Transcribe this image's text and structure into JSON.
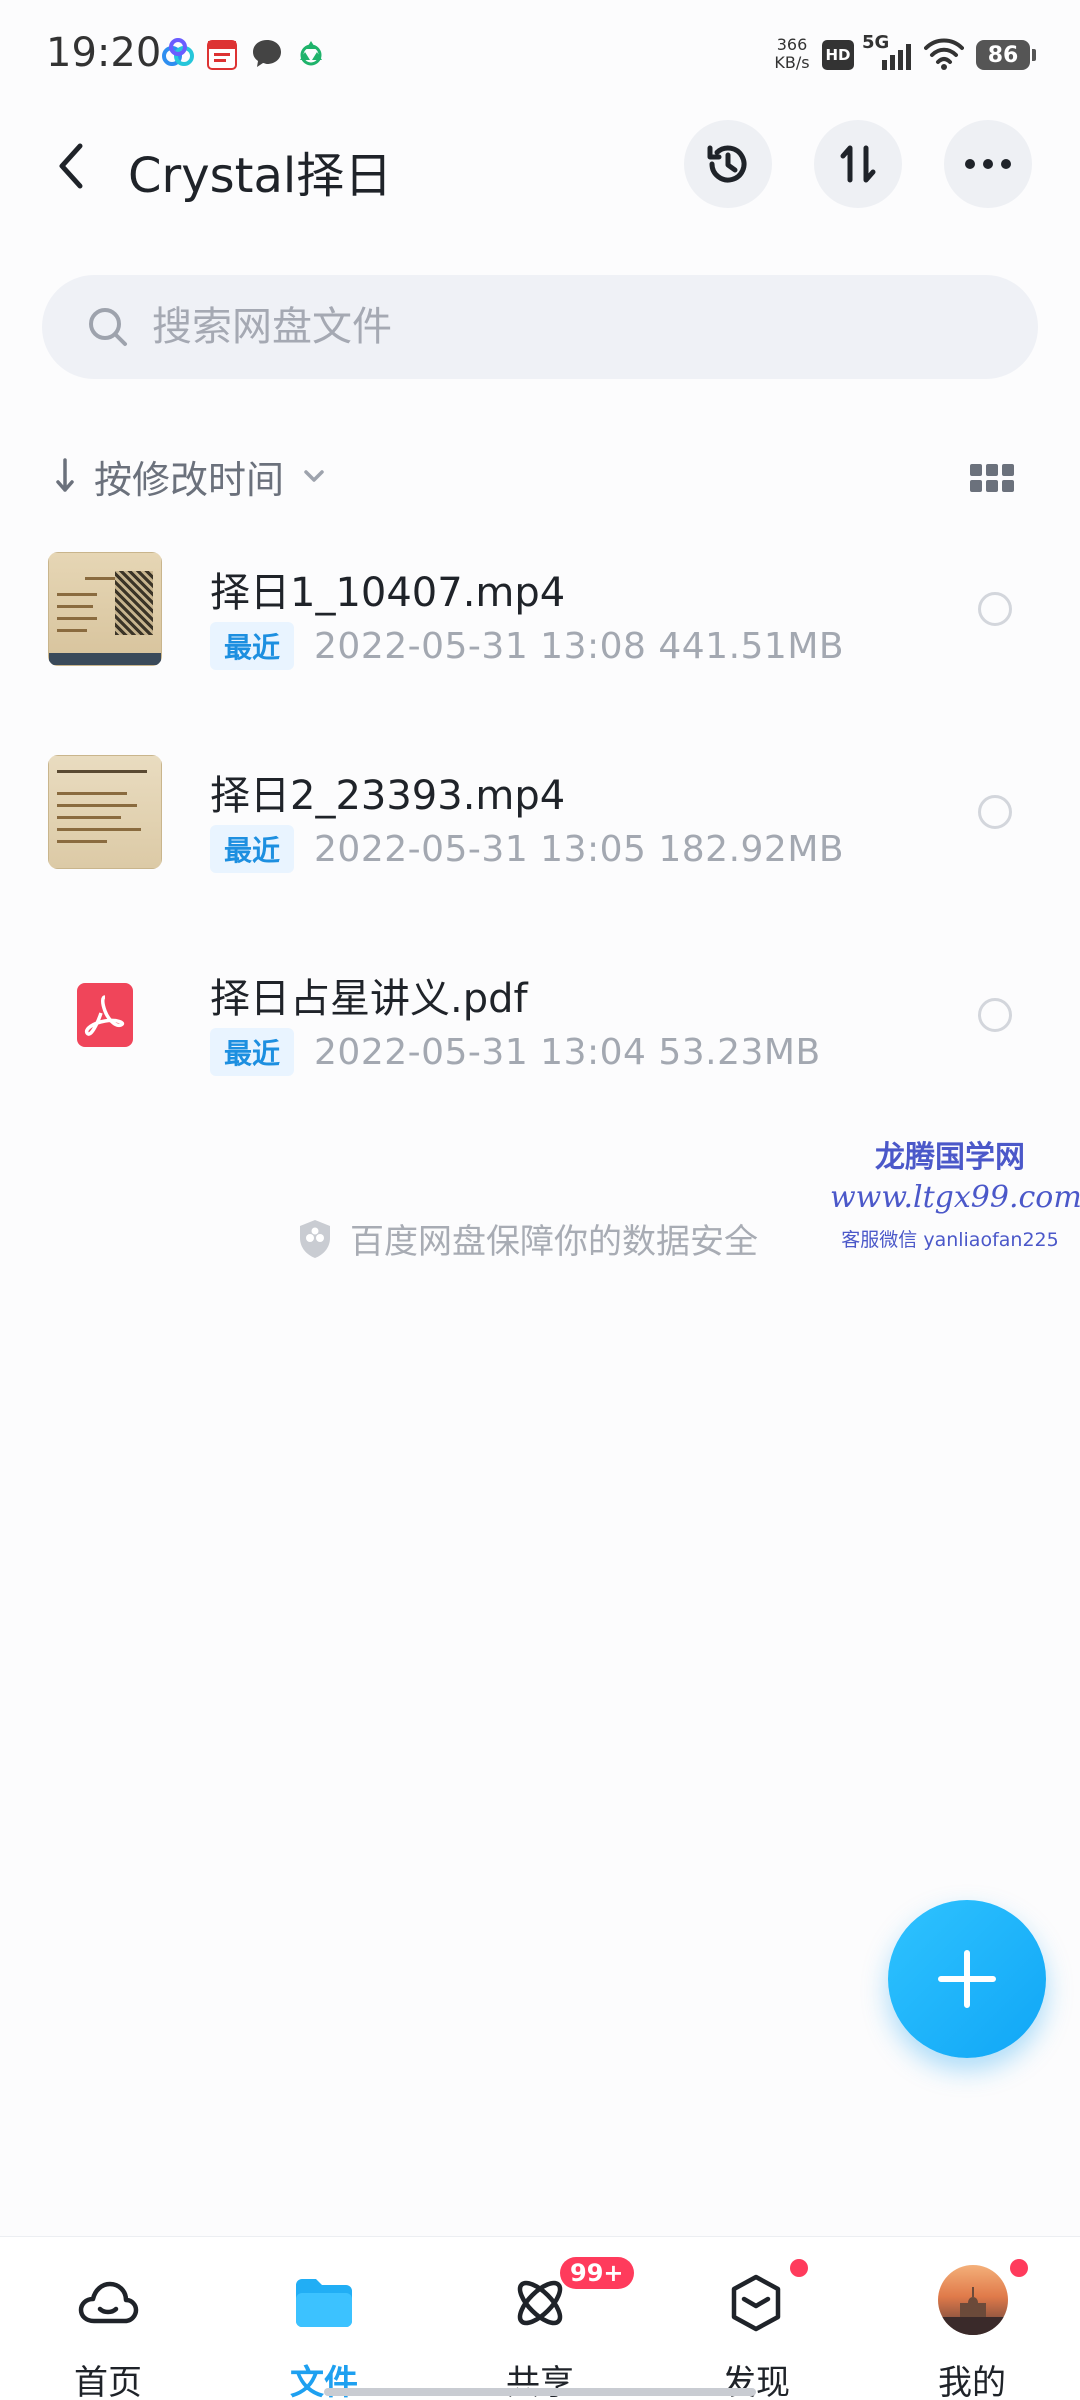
{
  "status_bar": {
    "time": "19:20",
    "net_speed_value": "366",
    "net_speed_unit": "KB/s",
    "hd_label": "HD",
    "network_label": "5G",
    "battery": "86"
  },
  "header": {
    "title": "Crystal择日"
  },
  "search": {
    "placeholder": "搜索网盘文件"
  },
  "sort": {
    "label": "按修改时间"
  },
  "files": [
    {
      "name": "择日1_10407.mp4",
      "tag": "最近",
      "meta": "2022-05-31  13:08   441.51MB",
      "type": "video"
    },
    {
      "name": "择日2_23393.mp4",
      "tag": "最近",
      "meta": "2022-05-31  13:05   182.92MB",
      "type": "video"
    },
    {
      "name": "择日占星讲义.pdf",
      "tag": "最近",
      "meta": "2022-05-31  13:04   53.23MB",
      "type": "pdf"
    }
  ],
  "footer": {
    "safety_text": "百度网盘保障你的数据安全"
  },
  "watermark": {
    "line1": "龙腾国学网",
    "line2": "www.ltgx99.com",
    "line3": "客服微信 yanliaofan225"
  },
  "nav": {
    "items": [
      {
        "label": "首页",
        "icon": "cloud-icon"
      },
      {
        "label": "文件",
        "icon": "folder-icon"
      },
      {
        "label": "共享",
        "icon": "atom-icon"
      },
      {
        "label": "发现",
        "icon": "cube-icon"
      },
      {
        "label": "我的",
        "icon": "avatar"
      }
    ],
    "share_badge": "99+"
  },
  "colors": {
    "accent": "#1ea0f0",
    "badge": "#ff3b5c",
    "pdf": "#f0455a"
  }
}
